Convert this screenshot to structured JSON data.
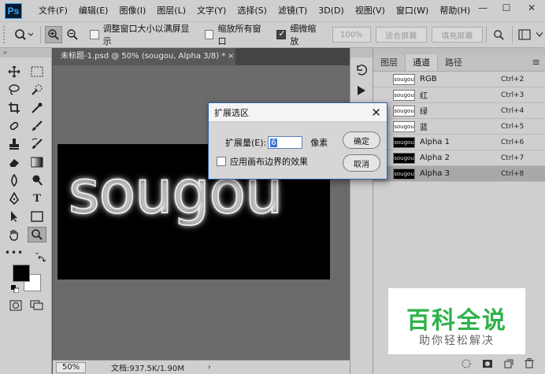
{
  "app": {
    "logo": "Ps",
    "menu": [
      "文件(F)",
      "编辑(E)",
      "图像(I)",
      "图层(L)",
      "文字(Y)",
      "选择(S)",
      "滤镜(T)",
      "3D(D)",
      "视图(V)",
      "窗口(W)",
      "帮助(H)"
    ],
    "window_controls": {
      "minimize": "—",
      "maximize": "☐",
      "close": "✕"
    }
  },
  "options_bar": {
    "resize_windows": {
      "label": "调整窗口大小以满屏显示",
      "checked": false
    },
    "zoom_all": {
      "label": "缩放所有窗口",
      "checked": false
    },
    "scrubby_zoom": {
      "label": "细微缩放",
      "checked": true
    },
    "btn_100": "100%",
    "btn_fit": "适合屏幕",
    "btn_fill": "填充屏幕"
  },
  "document": {
    "tab_title": "未标题-1.psd @ 50% (sougou, Alpha 3/8) *",
    "tab_close": "×",
    "canvas_text": "sougou",
    "zoom": "50%",
    "doc_info": "文档:937.5K/1.90M",
    "status_arrow": "›"
  },
  "panel": {
    "tabs": [
      "图层",
      "通道",
      "路径"
    ],
    "active_tab": "通道",
    "channels": [
      {
        "thumb": "sougou",
        "name": "RGB",
        "shortcut": "Ctrl+2",
        "thumb_style": "white",
        "selected": false
      },
      {
        "thumb": "sougou",
        "name": "红",
        "shortcut": "Ctrl+3",
        "thumb_style": "white",
        "selected": false
      },
      {
        "thumb": "sougou",
        "name": "绿",
        "shortcut": "Ctrl+4",
        "thumb_style": "white",
        "selected": false
      },
      {
        "thumb": "sougou",
        "name": "蓝",
        "shortcut": "Ctrl+5",
        "thumb_style": "white",
        "selected": false
      },
      {
        "thumb": "sougou",
        "name": "Alpha 1",
        "shortcut": "Ctrl+6",
        "thumb_style": "black",
        "selected": false
      },
      {
        "thumb": "sougou",
        "name": "Alpha 2",
        "shortcut": "Ctrl+7",
        "thumb_style": "black",
        "selected": false
      },
      {
        "thumb": "sougou",
        "name": "Alpha 3",
        "shortcut": "Ctrl+8",
        "thumb_style": "black",
        "selected": true
      }
    ]
  },
  "dialog": {
    "title": "扩展选区",
    "close": "✕",
    "expand_label": "扩展量(E):",
    "expand_value": "6",
    "unit": "像素",
    "apply_canvas_bounds": {
      "label": "应用画布边界的效果",
      "checked": false
    },
    "ok": "确定",
    "cancel": "取消"
  },
  "watermark": {
    "main": "百科全说",
    "sub": "助你轻松解决"
  },
  "colors": {
    "accent_blue": "#2f5fa8",
    "watermark_green": "#2fb24a",
    "foreground": "#000000",
    "background": "#ffffff"
  }
}
